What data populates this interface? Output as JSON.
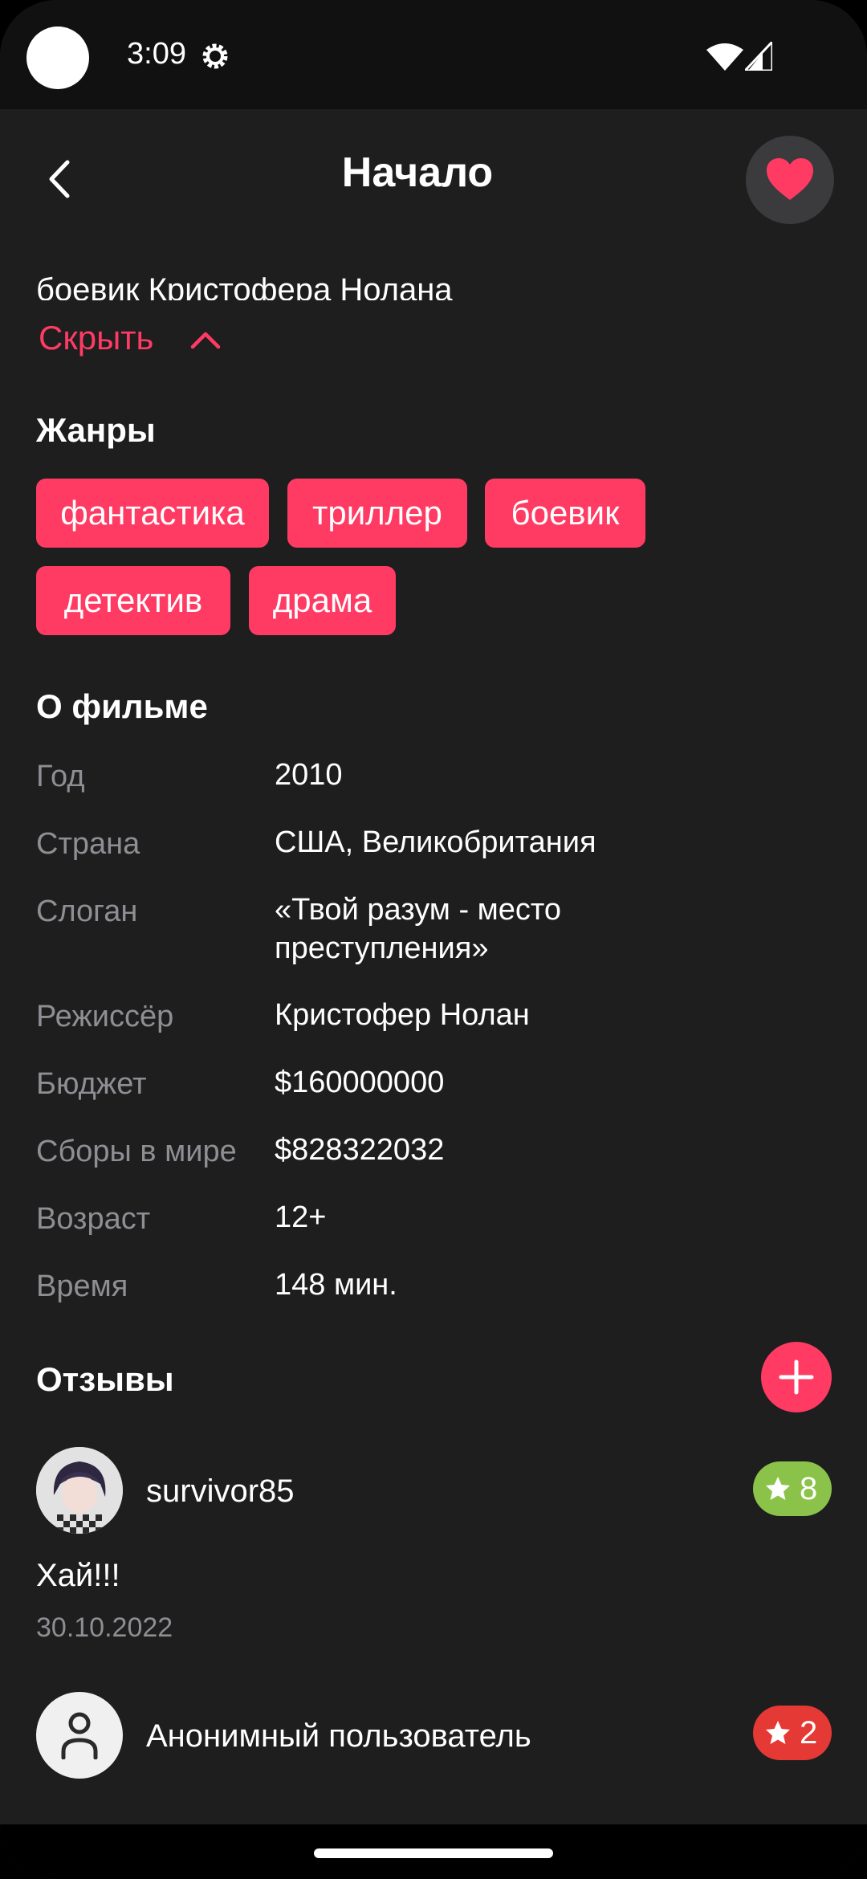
{
  "status_bar": {
    "time": "3:09"
  },
  "header": {
    "title": "Начало"
  },
  "description_tail": "боевик Кристофера Нолана",
  "hide_label": "Скрыть",
  "genres": {
    "heading": "Жанры",
    "items": [
      "фантастика",
      "триллер",
      "боевик",
      "детектив",
      "драма"
    ]
  },
  "about": {
    "heading": "О фильме",
    "rows": [
      {
        "label": "Год",
        "value": "2010"
      },
      {
        "label": "Страна",
        "value": "США, Великобритания"
      },
      {
        "label": "Слоган",
        "value": "«Твой разум - место",
        "value2": "преступления»"
      },
      {
        "label": "Режиссёр",
        "value": "Кристофер Нолан"
      },
      {
        "label": "Бюджет",
        "value": "$160000000"
      },
      {
        "label": "Сборы в мире",
        "value": "$828322032"
      },
      {
        "label": "Возраст",
        "value": "12+"
      },
      {
        "label": "Время",
        "value": "148 мин."
      }
    ]
  },
  "reviews": {
    "heading": "Отзывы",
    "items": [
      {
        "user": "survivor85",
        "rating": "8",
        "rating_color": "#8bc34a",
        "text": "Хай!!!",
        "date": "30.10.2022"
      },
      {
        "user": "Анонимный пользователь",
        "rating": "2",
        "rating_color": "#e53935"
      }
    ]
  },
  "colors": {
    "accent": "#ff3b64",
    "background": "#1e1e1f",
    "secondary_text": "#8e8e93"
  }
}
